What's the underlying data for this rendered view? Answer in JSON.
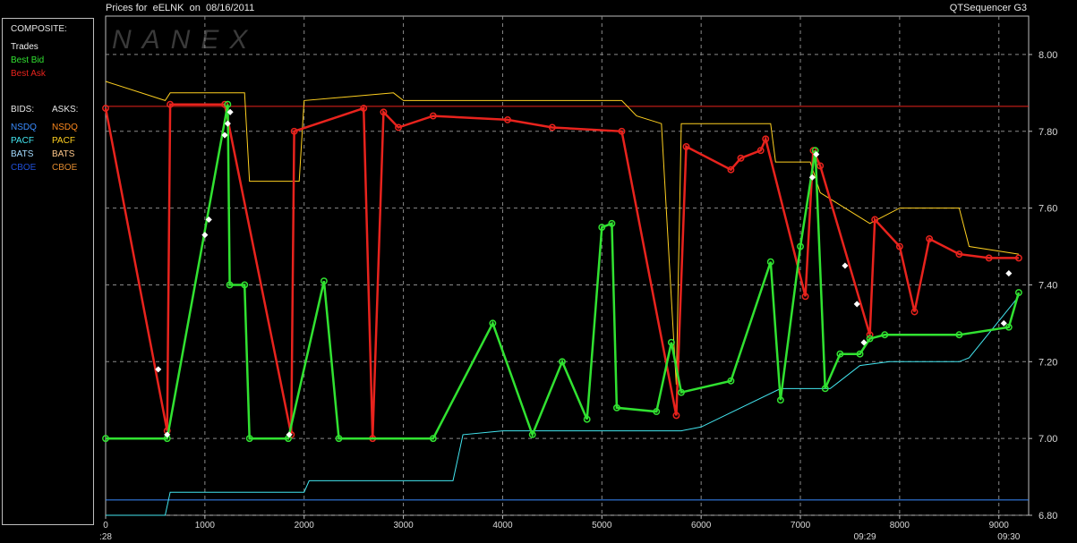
{
  "header": {
    "prices_for": "Prices for",
    "symbol": "eELNK",
    "on": "on",
    "date": "08/16/2011",
    "app_name": "QTSequencer G3"
  },
  "legend": {
    "composite_title": "COMPOSITE:",
    "composite_items": [
      {
        "label": "Trades",
        "color": "#f0f0f0"
      },
      {
        "label": "Best Bid",
        "color": "#31e231"
      },
      {
        "label": "Best Ask",
        "color": "#e8231d"
      }
    ],
    "bids_title": "BIDS:",
    "asks_title": "ASKS:",
    "bids": [
      {
        "label": "NSDQ",
        "color": "#3a8cff"
      },
      {
        "label": "PACF",
        "color": "#43e6f0"
      },
      {
        "label": "BATS",
        "color": "#a5dcff"
      },
      {
        "label": "CBOE",
        "color": "#2050d8"
      }
    ],
    "asks": [
      {
        "label": "NSDQ",
        "color": "#ff8a1e"
      },
      {
        "label": "PACF",
        "color": "#ffd020"
      },
      {
        "label": "BATS",
        "color": "#ffc88a"
      },
      {
        "label": "CBOE",
        "color": "#e08a30"
      }
    ]
  },
  "watermark": "NANEX",
  "chart_data": {
    "type": "line",
    "x_ticks": [
      0,
      1000,
      2000,
      3000,
      4000,
      5000,
      6000,
      7000,
      8000,
      9000
    ],
    "y_ticks": [
      "6.80",
      "7.00",
      "7.20",
      "7.40",
      "7.60",
      "7.80",
      "8.00"
    ],
    "time_labels": [
      {
        "x": 0,
        "label": ":28"
      },
      {
        "x": 7650,
        "label": "09:29"
      },
      {
        "x": 9100,
        "label": "09:30"
      }
    ],
    "xlim": [
      0,
      9300
    ],
    "ylim": [
      6.8,
      8.1
    ],
    "grid": true,
    "reference_lines": [
      {
        "name": "Best Ask reference",
        "y": 7.865,
        "color": "#e8231d"
      },
      {
        "name": "NSDQ bid reference",
        "y": 6.84,
        "color": "#3a8cff"
      }
    ],
    "series": [
      {
        "name": "Best Ask",
        "color": "#e8231d",
        "points": [
          [
            0,
            7.86
          ],
          [
            620,
            7.02
          ],
          [
            650,
            7.87
          ],
          [
            1200,
            7.87
          ],
          [
            1870,
            7.01
          ],
          [
            1900,
            7.8
          ],
          [
            2600,
            7.86
          ],
          [
            2690,
            7.0
          ],
          [
            2800,
            7.85
          ],
          [
            2950,
            7.81
          ],
          [
            3300,
            7.84
          ],
          [
            4050,
            7.83
          ],
          [
            4500,
            7.81
          ],
          [
            5200,
            7.8
          ],
          [
            5750,
            7.06
          ],
          [
            5850,
            7.76
          ],
          [
            6300,
            7.7
          ],
          [
            6400,
            7.73
          ],
          [
            6600,
            7.75
          ],
          [
            6650,
            7.78
          ],
          [
            7050,
            7.37
          ],
          [
            7130,
            7.75
          ],
          [
            7200,
            7.71
          ],
          [
            7700,
            7.27
          ],
          [
            7750,
            7.57
          ],
          [
            8000,
            7.5
          ],
          [
            8150,
            7.33
          ],
          [
            8300,
            7.52
          ],
          [
            8600,
            7.48
          ],
          [
            8900,
            7.47
          ],
          [
            9200,
            7.47
          ]
        ]
      },
      {
        "name": "Best Bid",
        "color": "#31e231",
        "points": [
          [
            0,
            7.0
          ],
          [
            620,
            7.0
          ],
          [
            1230,
            7.87
          ],
          [
            1250,
            7.4
          ],
          [
            1400,
            7.4
          ],
          [
            1450,
            7.0
          ],
          [
            1840,
            7.0
          ],
          [
            2200,
            7.41
          ],
          [
            2350,
            7.0
          ],
          [
            3300,
            7.0
          ],
          [
            3900,
            7.3
          ],
          [
            4300,
            7.01
          ],
          [
            4600,
            7.2
          ],
          [
            4850,
            7.05
          ],
          [
            5000,
            7.55
          ],
          [
            5100,
            7.56
          ],
          [
            5150,
            7.08
          ],
          [
            5550,
            7.07
          ],
          [
            5700,
            7.25
          ],
          [
            5800,
            7.12
          ],
          [
            6300,
            7.15
          ],
          [
            6700,
            7.46
          ],
          [
            6800,
            7.1
          ],
          [
            7000,
            7.5
          ],
          [
            7150,
            7.75
          ],
          [
            7250,
            7.13
          ],
          [
            7400,
            7.22
          ],
          [
            7600,
            7.22
          ],
          [
            7700,
            7.26
          ],
          [
            7850,
            7.27
          ],
          [
            8600,
            7.27
          ],
          [
            9100,
            7.29
          ],
          [
            9200,
            7.38
          ]
        ]
      },
      {
        "name": "Trades",
        "color": "#ffffff",
        "points": [
          [
            530,
            7.18
          ],
          [
            620,
            7.01
          ],
          [
            1000,
            7.53
          ],
          [
            1040,
            7.57
          ],
          [
            1200,
            7.79
          ],
          [
            1230,
            7.82
          ],
          [
            1255,
            7.85
          ],
          [
            1850,
            7.01
          ],
          [
            7120,
            7.68
          ],
          [
            7160,
            7.74
          ],
          [
            7450,
            7.45
          ],
          [
            7570,
            7.35
          ],
          [
            7640,
            7.25
          ],
          [
            9050,
            7.3
          ],
          [
            9100,
            7.43
          ]
        ]
      },
      {
        "name": "PACF ask",
        "color": "#ffd020",
        "points": [
          [
            0,
            7.93
          ],
          [
            600,
            7.88
          ],
          [
            650,
            7.9
          ],
          [
            1400,
            7.9
          ],
          [
            1450,
            7.67
          ],
          [
            1950,
            7.67
          ],
          [
            2000,
            7.88
          ],
          [
            2900,
            7.9
          ],
          [
            3000,
            7.88
          ],
          [
            5200,
            7.88
          ],
          [
            5350,
            7.84
          ],
          [
            5600,
            7.82
          ],
          [
            5750,
            7.14
          ],
          [
            5800,
            7.82
          ],
          [
            6700,
            7.82
          ],
          [
            6750,
            7.72
          ],
          [
            7100,
            7.72
          ],
          [
            7200,
            7.64
          ],
          [
            7700,
            7.56
          ],
          [
            8000,
            7.6
          ],
          [
            8600,
            7.6
          ],
          [
            8700,
            7.5
          ],
          [
            9200,
            7.48
          ]
        ]
      },
      {
        "name": "PACF bid",
        "color": "#43e6f0",
        "points": [
          [
            0,
            6.8
          ],
          [
            600,
            6.8
          ],
          [
            650,
            6.86
          ],
          [
            2000,
            6.86
          ],
          [
            2050,
            6.89
          ],
          [
            3500,
            6.89
          ],
          [
            3600,
            7.01
          ],
          [
            4000,
            7.02
          ],
          [
            5800,
            7.02
          ],
          [
            6000,
            7.03
          ],
          [
            6800,
            7.13
          ],
          [
            7300,
            7.13
          ],
          [
            7400,
            7.15
          ],
          [
            7600,
            7.19
          ],
          [
            7900,
            7.2
          ],
          [
            8600,
            7.2
          ],
          [
            8700,
            7.21
          ],
          [
            9200,
            7.37
          ]
        ]
      }
    ]
  }
}
